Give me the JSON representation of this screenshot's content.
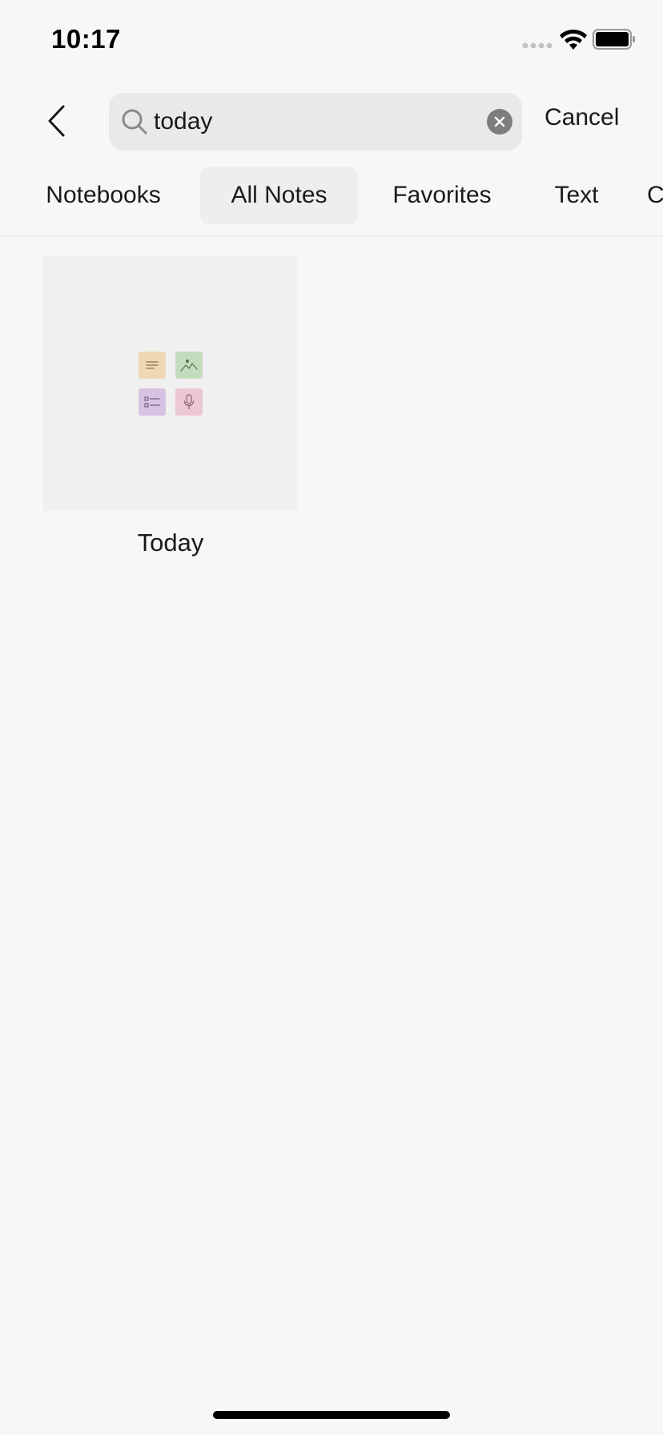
{
  "status_bar": {
    "time": "10:17"
  },
  "search": {
    "query": "today",
    "cancel_label": "Cancel"
  },
  "tabs": [
    {
      "label": "Notebooks",
      "active": false
    },
    {
      "label": "All Notes",
      "active": true
    },
    {
      "label": "Favorites",
      "active": false
    },
    {
      "label": "Text",
      "active": false
    },
    {
      "label": "C",
      "active": false
    }
  ],
  "results": [
    {
      "title": "Today",
      "tiles": [
        "text-note-icon",
        "image-note-icon",
        "checklist-note-icon",
        "audio-note-icon"
      ]
    }
  ],
  "colors": {
    "background": "#f7f7f7",
    "search_field": "#e9e9e9",
    "active_tab": "#eeeeee",
    "thumbnail": "#f0f0f0",
    "tile_text": "#f0d8b4",
    "tile_image": "#c4dcbe",
    "tile_list": "#d7c2e2",
    "tile_audio": "#ebc8d4"
  }
}
